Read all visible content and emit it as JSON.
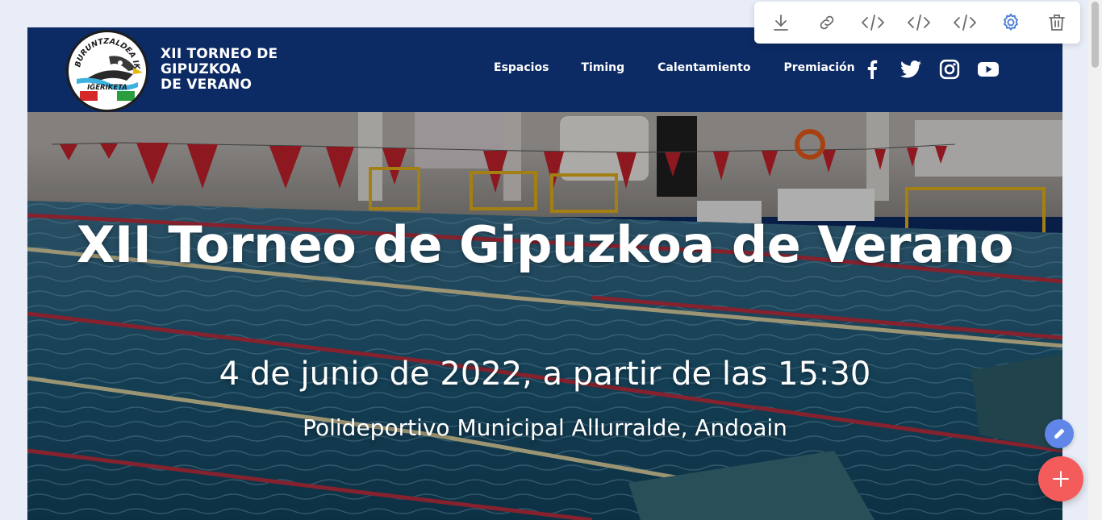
{
  "brand": {
    "title_lines": [
      "XII TORNEO DE",
      "GIPUZKOA",
      "DE VERANO"
    ],
    "logo_text_top": "BURUNTZALDEA IKT",
    "logo_text_bottom": "IGERIKETA"
  },
  "nav": {
    "links": [
      "Espacios",
      "Timing",
      "Calentamiento",
      "Premiación"
    ],
    "social_icons": [
      "facebook-icon",
      "twitter-icon",
      "instagram-icon",
      "youtube-icon"
    ]
  },
  "hero": {
    "title": "XII Torneo de Gipuzkoa de Verano",
    "date": "4 de junio de 2022, a partir de las 15:30",
    "venue": "Polideportivo Municipal Allurralde, Andoain"
  },
  "toolbar": {
    "icons": [
      "download-icon",
      "link-icon",
      "code-icon",
      "code-icon",
      "code-icon",
      "settings-icon",
      "trash-icon"
    ],
    "active_color": "#4b7bd6",
    "icon_color": "#6b6b6b"
  },
  "colors": {
    "navbar": "#0c2a63",
    "fab_edit": "#5f86e8",
    "fab_add": "#f45c5c"
  }
}
